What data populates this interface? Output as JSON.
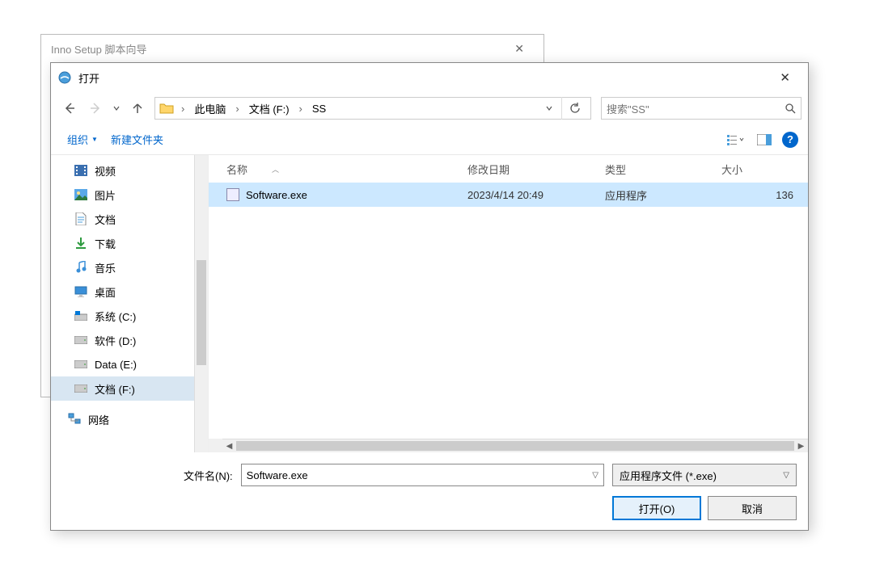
{
  "parent_window": {
    "title": "Inno Setup 脚本向导"
  },
  "dialog": {
    "title": "打开",
    "breadcrumb": {
      "seg1": "此电脑",
      "seg2": "文档 (F:)",
      "seg3": "SS"
    },
    "search": {
      "placeholder": "搜索\"SS\""
    },
    "toolbar": {
      "organize": "组织",
      "new_folder": "新建文件夹"
    },
    "tree": {
      "items": [
        {
          "label": "视频",
          "icon": "video"
        },
        {
          "label": "图片",
          "icon": "pictures"
        },
        {
          "label": "文档",
          "icon": "documents"
        },
        {
          "label": "下载",
          "icon": "downloads"
        },
        {
          "label": "音乐",
          "icon": "music"
        },
        {
          "label": "桌面",
          "icon": "desktop"
        },
        {
          "label": "系统 (C:)",
          "icon": "drive-win"
        },
        {
          "label": "软件 (D:)",
          "icon": "drive"
        },
        {
          "label": "Data (E:)",
          "icon": "drive"
        },
        {
          "label": "文档 (F:)",
          "icon": "drive",
          "selected": true
        }
      ],
      "network": {
        "label": "网络"
      }
    },
    "columns": {
      "name": "名称",
      "date": "修改日期",
      "type": "类型",
      "size": "大小"
    },
    "files": [
      {
        "name": "Software.exe",
        "date": "2023/4/14 20:49",
        "type": "应用程序",
        "size": "136",
        "selected": true
      }
    ],
    "footer": {
      "filename_label": "文件名(N):",
      "filename_value": "Software.exe",
      "filter_label": "应用程序文件 (*.exe)",
      "open_btn": "打开(O)",
      "cancel_btn": "取消"
    }
  }
}
